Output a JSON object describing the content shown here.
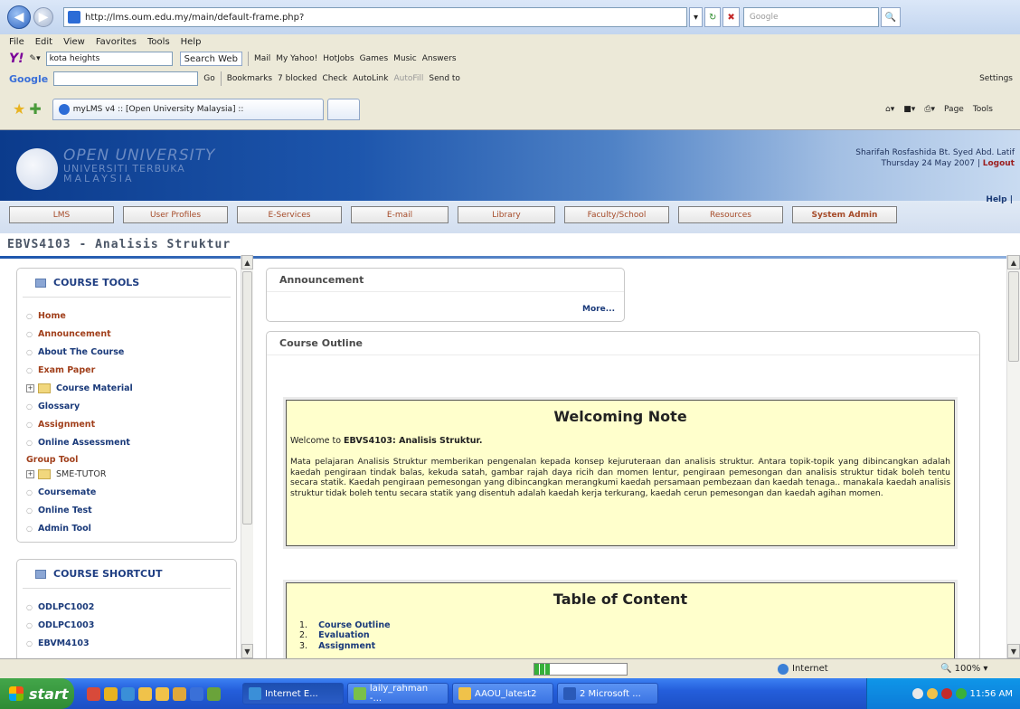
{
  "browser": {
    "url": "http://lms.oum.edu.my/main/default-frame.php?",
    "search_placeholder": "Google",
    "menu": [
      "File",
      "Edit",
      "View",
      "Favorites",
      "Tools",
      "Help"
    ],
    "yahoo_search_value": "kota heights",
    "yahoo_search_button": "Search Web",
    "yahoo_items": [
      "Mail",
      "My Yahoo!",
      "HotJobs",
      "Games",
      "Music",
      "Answers"
    ],
    "google_label": "Google",
    "google_go": "Go",
    "google_items": [
      "Bookmarks",
      "7 blocked",
      "Check",
      "AutoLink",
      "AutoFill",
      "Send to"
    ],
    "settings_label": "Settings",
    "tab_title": "myLMS v4 :: [Open University Malaysia] ::",
    "cmd_items": [
      "Page",
      "Tools"
    ],
    "status_zone": "Internet",
    "zoom": "100%"
  },
  "header": {
    "logo_line1": "OPEN UNIVERSITY",
    "logo_line2": "UNIVERSITI TERBUKA",
    "logo_line3": "MALAYSIA",
    "user_name": "Sharifah Rosfashida Bt. Syed Abd. Latif",
    "date": "Thursday 24 May 2007",
    "divider": "|",
    "logout": "Logout",
    "help": "Help |"
  },
  "nav": [
    {
      "label": "LMS",
      "w": 116
    },
    {
      "label": "User Profiles",
      "w": 116
    },
    {
      "label": "E-Services",
      "w": 116
    },
    {
      "label": "E-mail",
      "w": 108
    },
    {
      "label": "Library",
      "w": 108
    },
    {
      "label": "Faculty/School",
      "w": 116
    },
    {
      "label": "Resources",
      "w": 116
    },
    {
      "label": "System Admin",
      "w": 116
    }
  ],
  "course_title": "EBVS4103 - Analisis Struktur",
  "course_tools": {
    "heading": "COURSE TOOLS",
    "items": [
      {
        "label": "Home",
        "style": "red"
      },
      {
        "label": "Announcement",
        "style": "red"
      },
      {
        "label": "About The Course",
        "style": "blue"
      },
      {
        "label": "Exam Paper",
        "style": "red"
      },
      {
        "label": "Course Material",
        "style": "folder"
      },
      {
        "label": "Glossary",
        "style": "blue"
      },
      {
        "label": "Assignment",
        "style": "red"
      },
      {
        "label": "Online Assessment",
        "style": "blue"
      }
    ],
    "group_tool_label": "Group Tool",
    "group_items": [
      {
        "label": "SME-TUTOR",
        "style": "folder-plain"
      }
    ],
    "more_items": [
      {
        "label": "Coursemate",
        "style": "blue"
      },
      {
        "label": "Online Test",
        "style": "blue"
      },
      {
        "label": "Admin Tool",
        "style": "blue"
      }
    ]
  },
  "course_shortcut": {
    "heading": "COURSE SHORTCUT",
    "items": [
      "ODLPC1002",
      "ODLPC1003",
      "EBVM4103"
    ]
  },
  "announcement": {
    "heading": "Announcement",
    "more": "More..."
  },
  "course_outline": {
    "heading": "Course Outline",
    "welcoming_title": "Welcoming Note",
    "welcome_prefix": "Welcome to ",
    "welcome_bold": "EBVS4103: Analisis Struktur.",
    "welcome_paragraph": "Mata pelajaran Analisis Struktur memberikan pengenalan kepada konsep kejuruteraan dan analisis struktur. Antara topik-topik yang dibincangkan adalah kaedah pengiraan tindak balas, kekuda satah, gambar rajah daya ricih dan momen lentur, pengiraan pemesongan dan analisis struktur tidak boleh tentu secara statik. Kaedah pengiraan pemesongan yang dibincangkan merangkumi kaedah persamaan pembezaan dan kaedah tenaga.. manakala kaedah analisis struktur tidak boleh tentu secara statik yang disentuh adalah kaedah kerja terkurang, kaedah cerun pemesongan dan kaedah agihan momen.",
    "toc_title": "Table of Content",
    "toc": [
      {
        "num": "1.",
        "label": "Course Outline"
      },
      {
        "num": "2.",
        "label": "Evaluation"
      },
      {
        "num": "3.",
        "label": "Assignment"
      }
    ]
  },
  "taskbar": {
    "start": "start",
    "buttons": [
      "Internet E...",
      "laily_rahman -...",
      "AAOU_latest2",
      "2 Microsoft ..."
    ],
    "clock": "11:56 AM"
  }
}
